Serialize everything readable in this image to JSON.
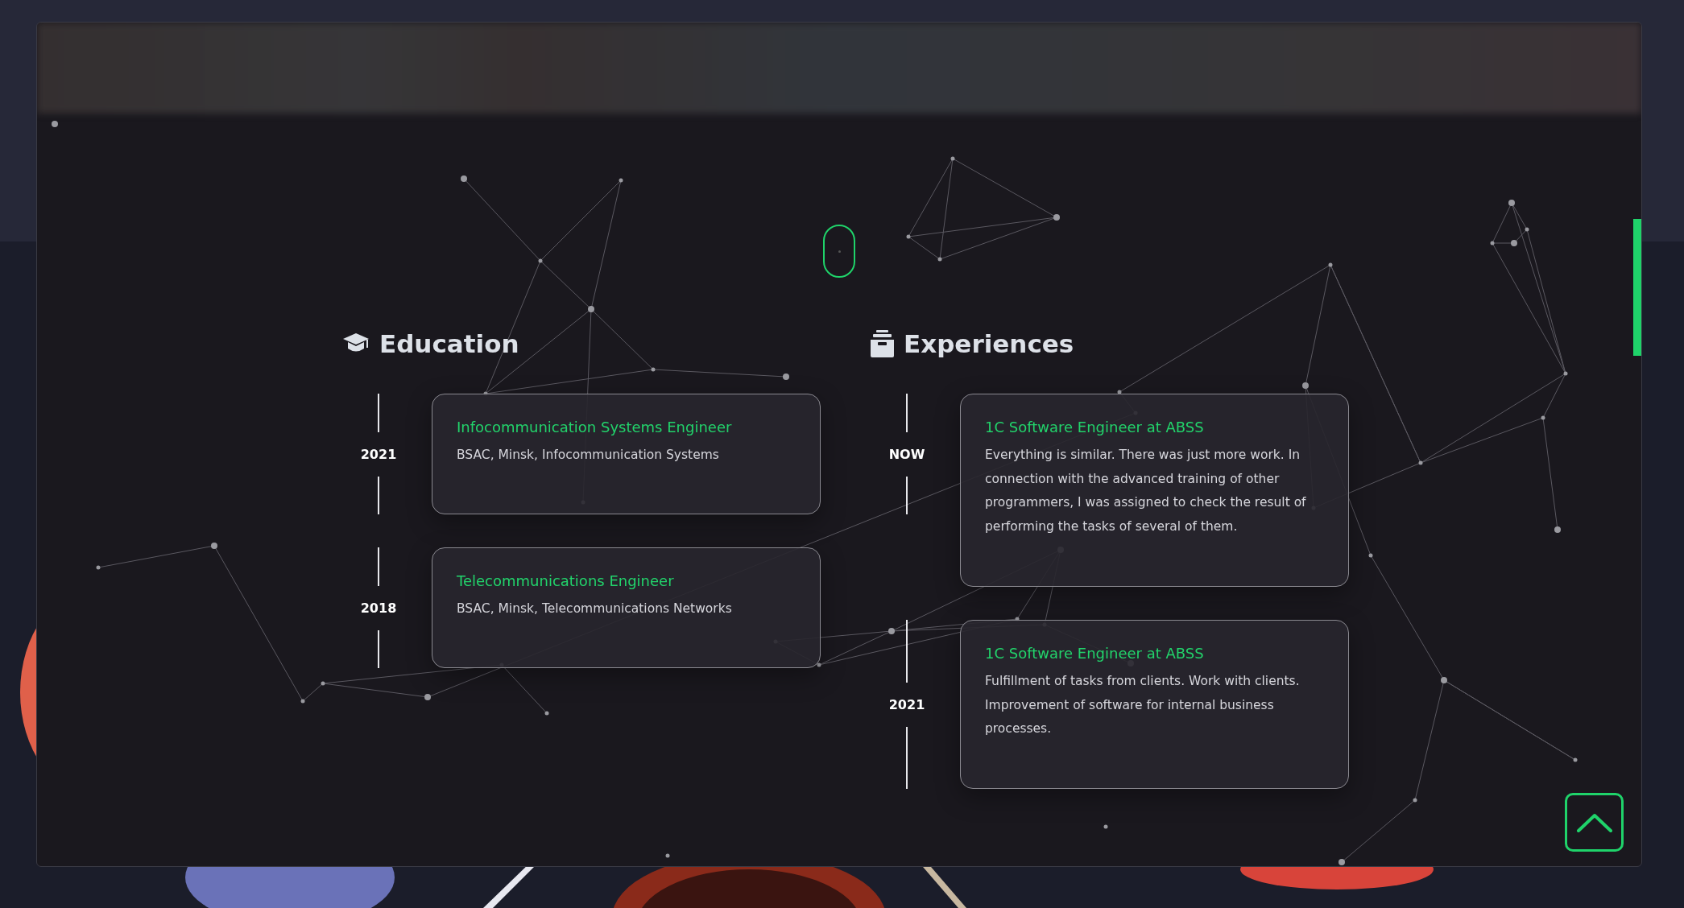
{
  "education": {
    "title": "Education",
    "items": [
      {
        "year": "2021",
        "title": "Infocommunication Systems Engineer",
        "detail": "BSAC, Minsk, Infocommunication Systems"
      },
      {
        "year": "2018",
        "title": "Telecommunications Engineer",
        "detail": "BSAC, Minsk, Telecommunications Networks"
      }
    ]
  },
  "experiences": {
    "title": "Experiences",
    "items": [
      {
        "year": "NOW",
        "title": "1C Software Engineer at ABSS",
        "detail": "Everything is similar. There was just more work. In connection with the advanced training of other programmers, I was assigned to check the result of performing the tasks of several of them."
      },
      {
        "year": "2021",
        "title": "1C Software Engineer at ABSS",
        "detail": "Fulfillment of tasks from clients. Work with clients. Improvement of software for internal business processes."
      }
    ]
  }
}
